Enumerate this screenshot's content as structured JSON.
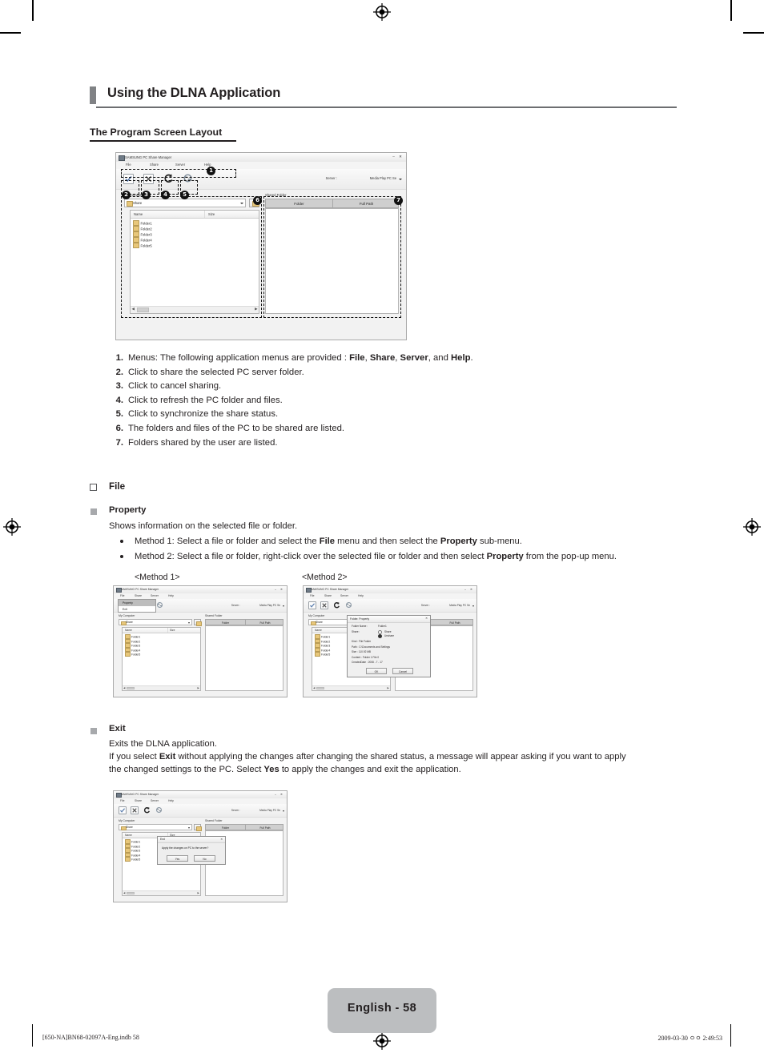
{
  "page": {
    "chapter_title": "Using the DLNA Application",
    "section_title": "The Program Screen Layout",
    "page_badge": "English - 58",
    "footer_left": "[650-NA]BN68-02097A-Eng.indb  58",
    "footer_right": "2009-03-30  ㅇㅇ 2:49:53"
  },
  "figure_main": {
    "window_title": "SAMSUNG PC Share Manager",
    "window_buttons": {
      "minimize": "–",
      "close": "✕"
    },
    "menus": [
      "File",
      "Share",
      "Server",
      "Help"
    ],
    "toolbar_icons": [
      "share-check-icon",
      "cancel-share-icon",
      "refresh-icon",
      "sync-icon"
    ],
    "server_label": "Server :",
    "server_value": "Media Play PC Se",
    "left_pane_label": "My Computer",
    "path_combo_value": "Share",
    "columns": [
      "Name",
      "Size"
    ],
    "folders": [
      "Folder1",
      "Folder2",
      "Folder3",
      "Folder4",
      "Folder5"
    ],
    "right_pane_label": "Shared Folder",
    "right_columns": [
      "Folder",
      "Full Path"
    ],
    "callouts": [
      "1",
      "2",
      "3",
      "4",
      "5",
      "6",
      "7"
    ]
  },
  "numbered_notes": [
    {
      "n": "1.",
      "text": "Menus: The following application menus are provided : ",
      "bold_parts": [
        "File",
        "Share",
        "Server",
        "Help"
      ],
      "tail": ""
    },
    {
      "n": "2.",
      "text": "Click to share the selected PC server folder."
    },
    {
      "n": "3.",
      "text": "Click to cancel sharing."
    },
    {
      "n": "4.",
      "text": "Click to refresh the PC folder and files."
    },
    {
      "n": "5.",
      "text": "Click to synchronize the share status."
    },
    {
      "n": "6.",
      "text": "The folders and files of the PC to be shared are listed."
    },
    {
      "n": "7.",
      "text": "Folders shared by the user are listed."
    }
  ],
  "file_section": {
    "heading": "File",
    "property": {
      "heading": "Property",
      "description": "Shows information on the selected file or folder.",
      "method1_text_a": "Method 1: Select a file or folder and select the ",
      "method1_bold_a": "File",
      "method1_text_b": " menu and then select the ",
      "method1_bold_b": "Property",
      "method1_text_c": " sub-menu.",
      "method2_text_a": "Method 2: Select a file or folder, right-click over the selected file or folder and then select ",
      "method2_bold_a": "Property",
      "method2_text_b": " from the pop-up menu.",
      "caption1": "<Method 1>",
      "caption2": "<Method 2>"
    },
    "exit": {
      "heading": "Exit",
      "line1": "Exits the DLNA application.",
      "line2_a": "If you select ",
      "line2_bold_a": "Exit",
      "line2_b": " without applying the changes after changing the shared status, a message will appear asking if you want to apply",
      "line3_a": "the changed settings to the PC. Select ",
      "line3_bold_a": "Yes",
      "line3_b": " to apply the changes and exit the application."
    }
  },
  "figure_method1": {
    "window_title": "SAMSUNG PC Share Manager",
    "menus": [
      "File",
      "Share",
      "Server",
      "Help"
    ],
    "open_menu_items": [
      "Property",
      "Exit"
    ],
    "open_menu_selected": "Property",
    "server_label": "Server :",
    "server_value": "Media Play PC Se",
    "left_pane_label": "My Computer",
    "path_combo_value": "Share",
    "columns": [
      "Name",
      "Size"
    ],
    "folders": [
      "Folder1",
      "Folder2",
      "Folder3",
      "Folder4",
      "Folder5"
    ],
    "right_pane_label": "Shared Folder",
    "right_columns": [
      "Folder",
      "Full Path"
    ]
  },
  "figure_method2": {
    "window_title": "SAMSUNG PC Share Manager",
    "menus": [
      "File",
      "Share",
      "Server",
      "Help"
    ],
    "server_label": "Server :",
    "server_value": "Media Play PC Se",
    "left_pane_label": "My Computer",
    "path_combo_value": "Share",
    "columns": [
      "Name",
      "Size"
    ],
    "folders": [
      "Folder1",
      "Folder2",
      "Folder3",
      "Folder4",
      "Folder5"
    ],
    "right_columns": [
      "Folder",
      "Full Path"
    ],
    "dialog": {
      "title": "Folder. Property",
      "close": "✕",
      "folder_name_label": "Folder Name :",
      "folder_name_value": "Folder1",
      "share_label": "Share :",
      "share_option": "Share",
      "unshare_option": "Unshare",
      "kind": "Kind : File Folder",
      "path": "Path :     C:\\Documents and Settings",
      "size": "Size : 110.92 MB",
      "content": "Content : Folder  1 File  0",
      "created": "CreatedDate : 2008 - 7 - 17",
      "ok": "OK",
      "cancel": "Cancel"
    }
  },
  "figure_exit": {
    "window_title": "SAMSUNG PC Share Manager",
    "menus": [
      "File",
      "Share",
      "Server",
      "Help"
    ],
    "server_label": "Server :",
    "server_value": "Media Play PC Se",
    "left_pane_label": "My Computer",
    "path_combo_value": "Share",
    "columns": [
      "Name",
      "Size"
    ],
    "folders": [
      "Folder1",
      "Folder2",
      "Folder3",
      "Folder4",
      "Folder5"
    ],
    "right_pane_label": "Shared Folder",
    "right_columns": [
      "Folder",
      "Full Path"
    ],
    "dialog": {
      "title": "End",
      "close": "✕",
      "message": "Apply the changes on PC to the server?",
      "yes": "Yes",
      "no": "No"
    }
  },
  "colors": {
    "accent_gray": "#808285",
    "badge_gray": "#bcbec0",
    "ink": "#231f20"
  }
}
